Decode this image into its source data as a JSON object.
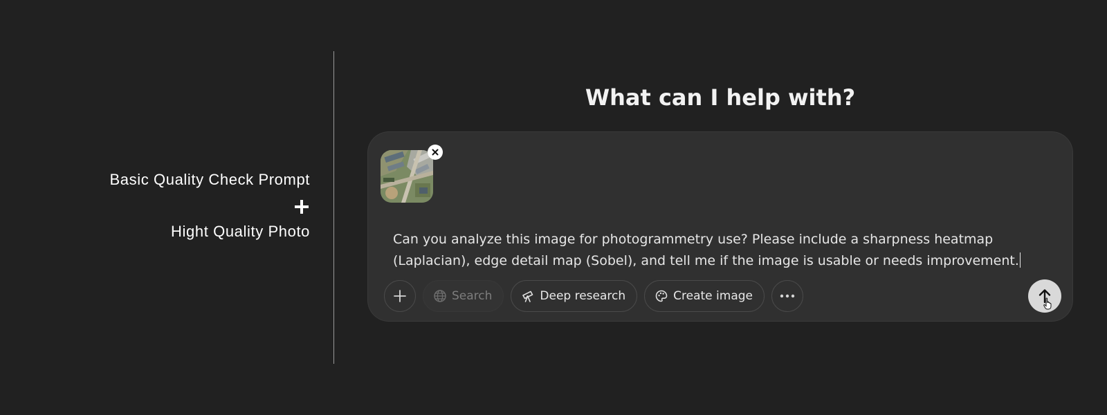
{
  "left": {
    "line1": "Basic Quality Check Prompt",
    "plus_icon": "plus-icon",
    "line2": "Hight Quality Photo"
  },
  "chat": {
    "heading": "What can I help with?",
    "attachment": {
      "icon": "aerial-photo-thumbnail",
      "remove_icon": "close-icon"
    },
    "prompt": "Can you analyze this image for photogrammetry use? Please include a sharpness heatmap (Laplacian), edge detail map (Sobel), and tell me if the image is usable or needs improvement.",
    "toolbar": {
      "add_icon": "plus-icon",
      "search_label": "Search",
      "search_icon": "globe-icon",
      "deep_research_label": "Deep research",
      "deep_research_icon": "telescope-icon",
      "create_image_label": "Create image",
      "create_image_icon": "palette-icon",
      "more_icon": "ellipsis-icon"
    },
    "send_icon": "arrow-up-icon"
  },
  "colors": {
    "background": "#212121",
    "composer": "#303030",
    "send_button": "#d9d9d9"
  }
}
